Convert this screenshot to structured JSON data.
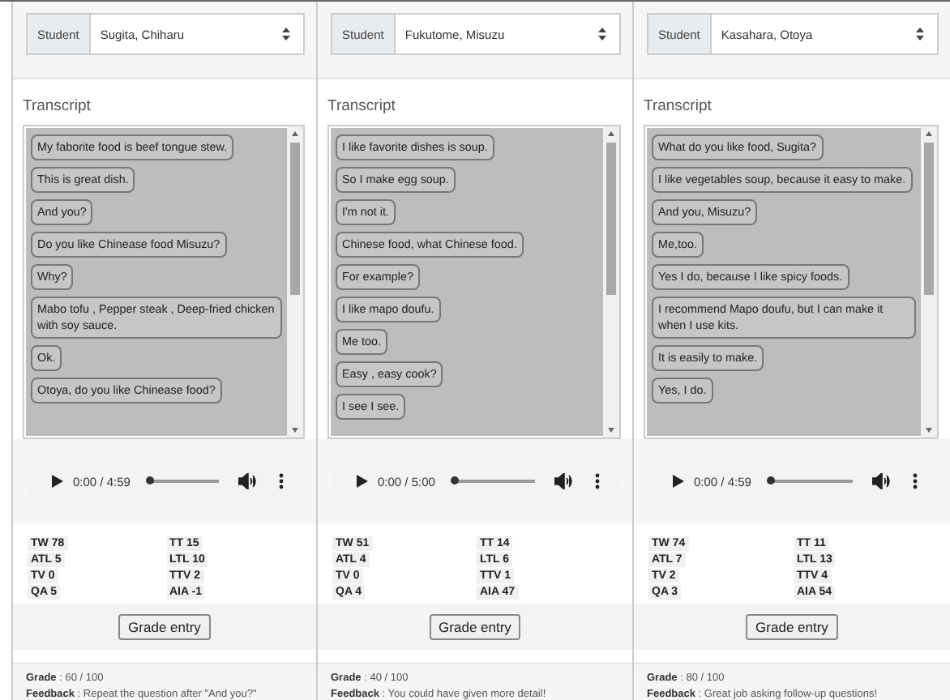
{
  "columns": [
    {
      "student_label": "Student",
      "student": "Sugita, Chiharu",
      "transcript_title": "Transcript",
      "messages": [
        "My faborite food is beef tongue stew.",
        "This is great dish.",
        "And you?",
        "Do you like Chinease food Misuzu?",
        "Why?",
        "Mabo tofu , Pepper steak , Deep-fried chicken with soy sauce.",
        "Ok.",
        "Otoya, do you like Chinease food?"
      ],
      "audio": {
        "time": "0:00 / 4:59",
        "level": 0
      },
      "stats": [
        "TW 78",
        "TT 15",
        "ATL 5",
        "LTL 10",
        "TV 0",
        "TTV 2",
        "QA 5",
        "AIA -1"
      ],
      "grade_button": "Grade entry",
      "grade": "**Grade** : 60 / 100",
      "feedback": "**Feedback** : Repeat the question after \"And you?\""
    },
    {
      "student_label": "Student",
      "student": "Fukutome, Misuzu",
      "transcript_title": "Transcript",
      "messages": [
        "I like favorite dishes is soup.",
        "So I make egg soup.",
        "I'm not it.",
        "Chinese food, what Chinese food.",
        "For example?",
        "I like mapo doufu.",
        "Me too.",
        "Easy , easy cook?",
        "I see I see."
      ],
      "audio": {
        "time": "0:00 / 5:00",
        "level": 0
      },
      "stats": [
        "TW 51",
        "TT 14",
        "ATL 4",
        "LTL 6",
        "TV 0",
        "TTV 1",
        "QA 4",
        "AIA 47"
      ],
      "grade_button": "Grade entry",
      "grade": "**Grade** : 40 / 100",
      "feedback": "**Feedback** : You could have given more detail!"
    },
    {
      "student_label": "Student",
      "student": "Kasahara, Otoya",
      "transcript_title": "Transcript",
      "messages": [
        "What do you like food, Sugita?",
        "I like vegetables soup, because it easy to make.",
        "And you, Misuzu?",
        "Me,too.",
        "Yes I do, because I like spicy foods.",
        "I recommend Mapo doufu, but I can make it when I use kits.",
        "It is easily to make.",
        "Yes, I do."
      ],
      "audio": {
        "time": "0:00 / 4:59",
        "level": 0
      },
      "stats": [
        "TW 74",
        "TT 11",
        "ATL 7",
        "LTL 13",
        "TV 2",
        "TTV 4",
        "QA 3",
        "AIA 54"
      ],
      "grade_button": "Grade entry",
      "grade": "**Grade** : 80 / 100",
      "feedback": "**Feedback** : Great job asking follow-up questions!"
    }
  ]
}
